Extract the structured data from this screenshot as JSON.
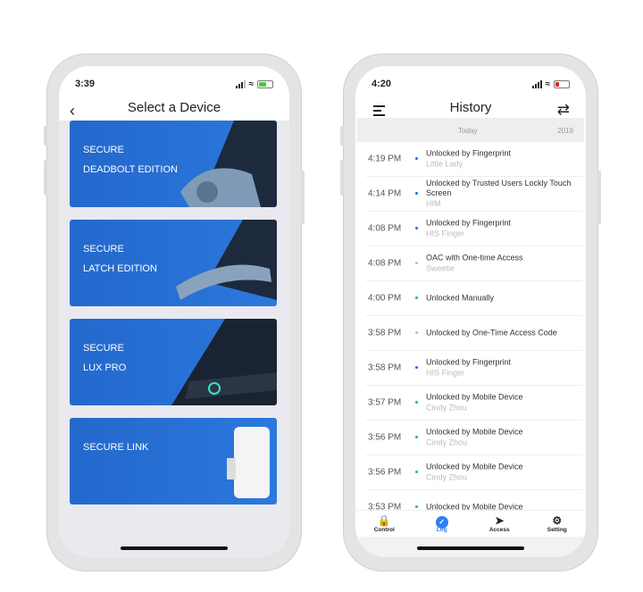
{
  "left": {
    "status_time": "3:39",
    "title": "Select a Device",
    "battery_color": "#3ccf3c",
    "cards": [
      {
        "line1": "SECURE",
        "line2": "DEADBOLT EDITION"
      },
      {
        "line1": "SECURE",
        "line2": "LATCH EDITION"
      },
      {
        "line1": "SECURE",
        "line2": "LUX PRO"
      },
      {
        "line1": "SECURE LINK",
        "line2": ""
      }
    ]
  },
  "right": {
    "status_time": "4:20",
    "title": "History",
    "battery_color": "#e02020",
    "band": {
      "today": "Today",
      "year": "2019"
    },
    "colors": {
      "blue": "#1a6fe0",
      "grey": "#bbbbbb",
      "green": "#2bb673",
      "accent": "#2f7ff0"
    },
    "rows": [
      {
        "time": "4:19 PM",
        "event": "Unlocked by Fingerprint",
        "user": "Little Lady",
        "dot": "blue"
      },
      {
        "time": "4:14 PM",
        "event": "Unlocked by Trusted Users Lockly Touch Screen",
        "user": "HIM",
        "dot": "blue"
      },
      {
        "time": "4:08 PM",
        "event": "Unlocked by Fingerprint",
        "user": "HIS Finger",
        "dot": "blue"
      },
      {
        "time": "4:08 PM",
        "event": "OAC with One-time Access",
        "user": "Sweetie",
        "dot": "grey"
      },
      {
        "time": "4:00 PM",
        "event": "Unlocked Manually",
        "user": "",
        "dot": "green"
      },
      {
        "time": "3:58 PM",
        "event": "Unlocked by One-Time Access Code",
        "user": "",
        "dot": "grey"
      },
      {
        "time": "3:58 PM",
        "event": "Unlocked by Fingerprint",
        "user": "HIS Finger",
        "dot": "blue"
      },
      {
        "time": "3:57 PM",
        "event": "Unlocked by Mobile Device",
        "user": "Cindy Zhou",
        "dot": "green"
      },
      {
        "time": "3:56 PM",
        "event": "Unlocked by Mobile Device",
        "user": "Cindy Zhou",
        "dot": "green"
      },
      {
        "time": "3:56 PM",
        "event": "Unlocked by Mobile Device",
        "user": "Cindy Zhou",
        "dot": "green"
      },
      {
        "time": "3:53 PM",
        "event": "Unlocked by Mobile Device",
        "user": "",
        "dot": "green"
      }
    ],
    "tabs": [
      {
        "label": "Control",
        "icon": "lock-icon",
        "active": false
      },
      {
        "label": "Log",
        "icon": "clock-icon",
        "active": true
      },
      {
        "label": "Access",
        "icon": "send-icon",
        "active": false
      },
      {
        "label": "Setting",
        "icon": "gear-icon",
        "active": false
      }
    ]
  }
}
